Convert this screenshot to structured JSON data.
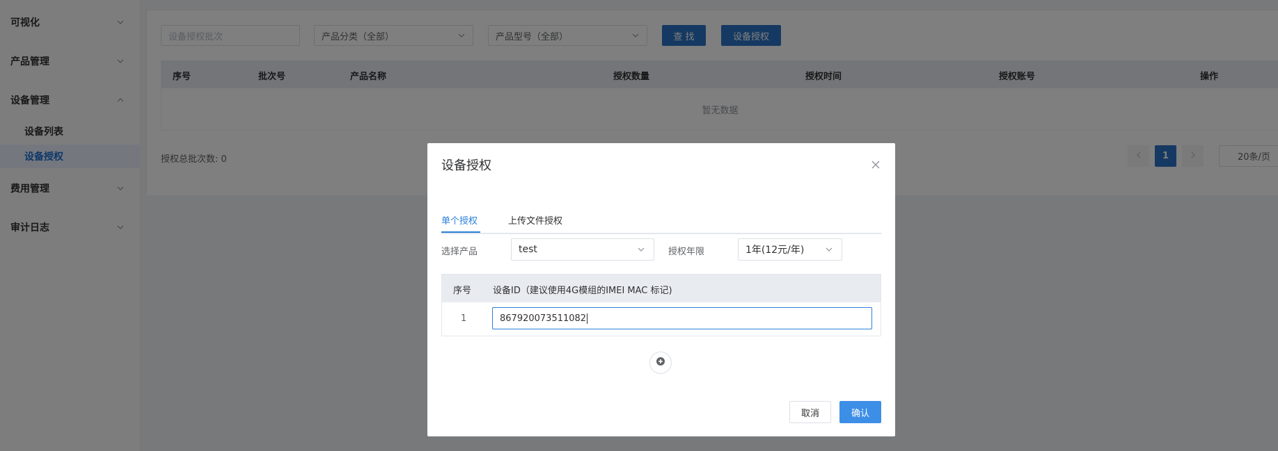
{
  "sidebar": {
    "groups": [
      {
        "label": "可视化"
      },
      {
        "label": "产品管理"
      },
      {
        "label": "设备管理"
      },
      {
        "label": "费用管理"
      },
      {
        "label": "审计日志"
      }
    ],
    "sub_items": [
      {
        "label": "设备列表"
      },
      {
        "label": "设备授权",
        "active": true
      }
    ]
  },
  "filters": {
    "batch_placeholder": "设备授权批次",
    "category_select": "产品分类（全部）",
    "model_select": "产品型号（全部）",
    "search_button": "查 找",
    "authorize_button": "设备授权"
  },
  "table": {
    "columns": [
      "序号",
      "批次号",
      "产品名称",
      "授权数量",
      "授权时间",
      "授权账号",
      "操作"
    ],
    "empty_text": "暂无数据"
  },
  "summary": {
    "total_text": "授权总批次数: 0"
  },
  "pagination": {
    "current_page": "1",
    "page_size": "20条/页"
  },
  "modal": {
    "title": "设备授权",
    "tabs": [
      {
        "label": "单个授权",
        "active": true
      },
      {
        "label": "上传文件授权",
        "active": false
      }
    ],
    "product_label": "选择产品",
    "product_value": "test",
    "years_label": "授权年限",
    "years_value": "1年(12元/年)",
    "table": {
      "col_index": "序号",
      "col_device": "设备ID（建议使用4G模组的IMEI MAC 标记)",
      "rows": [
        {
          "index": "1",
          "device_id": "867920073511082"
        }
      ]
    },
    "cancel_label": "取消",
    "confirm_label": "确认"
  },
  "colors": {
    "primary": "#2a73c4",
    "accent": "#3d8ee6",
    "active_menu_bg": "#e8f1fd"
  },
  "icons": [
    "chevron-down-icon",
    "chevron-up-icon",
    "close-icon",
    "plus-circle-icon",
    "chevron-left-icon",
    "chevron-right-icon"
  ]
}
